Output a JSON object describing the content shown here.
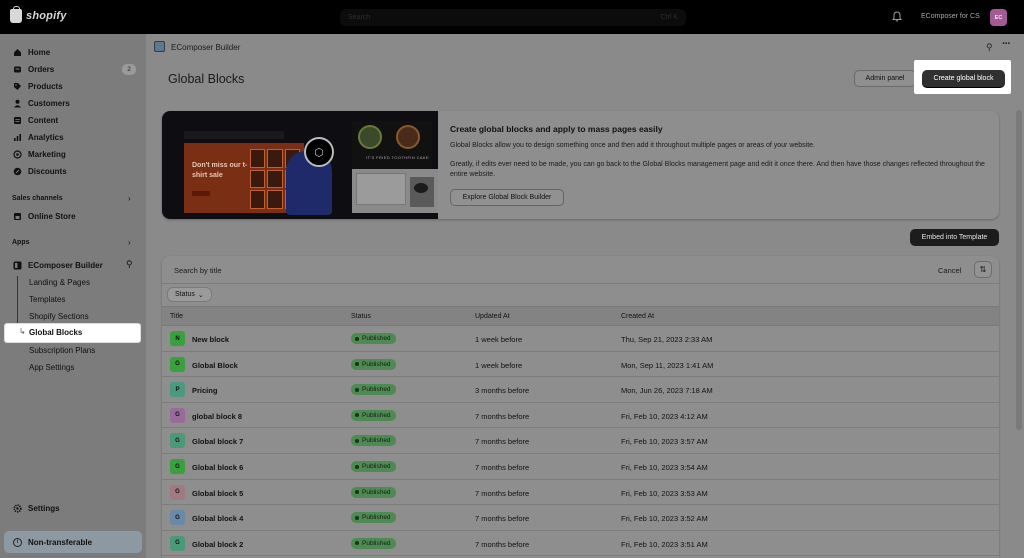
{
  "topbar": {
    "brand": "shopify",
    "search_placeholder": "Search",
    "search_shortcut": "Ctrl K",
    "store_name": "EComposer for CS",
    "avatar_initials": "EC"
  },
  "sidebar": {
    "items": [
      {
        "label": "Home",
        "icon": "home-icon"
      },
      {
        "label": "Orders",
        "icon": "orders-icon",
        "badge": "2"
      },
      {
        "label": "Products",
        "icon": "tag-icon"
      },
      {
        "label": "Customers",
        "icon": "person-icon"
      },
      {
        "label": "Content",
        "icon": "content-icon"
      },
      {
        "label": "Analytics",
        "icon": "analytics-icon"
      },
      {
        "label": "Marketing",
        "icon": "target-icon"
      },
      {
        "label": "Discounts",
        "icon": "discount-icon"
      }
    ],
    "sales_channels_title": "Sales channels",
    "online_store": "Online Store",
    "apps_title": "Apps",
    "app_name": "EComposer Builder",
    "sub_items": [
      "Landing & Pages",
      "Templates",
      "Shopify Sections",
      "Global Blocks",
      "Subscription Plans",
      "App Settings"
    ],
    "settings": "Settings",
    "non_transferable": "Non-transferable"
  },
  "app_header": {
    "title": "EComposer Builder"
  },
  "page": {
    "title": "Global Blocks",
    "admin_panel": "Admin panel",
    "create_button": "Create global block"
  },
  "banner": {
    "image_text": "Don't miss our t-shirt sale",
    "image_caption": "IT'S FRIED TOOTHFIN CAKE",
    "heading": "Create global blocks and apply to mass pages easily",
    "paragraph1": "Global Blocks allow you to design something once and then add it throughout multiple pages or areas of your website.",
    "paragraph2": "Greatly, if edits ever need to be made, you can go back to the Global Blocks management page and edit it once there. And then have those changes reflected throughout the entire website.",
    "explore_button": "Explore Global Block Builder"
  },
  "embed_button": "Embed into Template",
  "table": {
    "search_placeholder": "Search by title",
    "cancel": "Cancel",
    "status_filter": "Status",
    "columns": [
      "Title",
      "Status",
      "Updated At",
      "Created At"
    ],
    "rows": [
      {
        "initial": "N",
        "color": "#3aa03e",
        "title": "New block",
        "status": "Published",
        "updated": "1 week before",
        "created": "Thu, Sep 21, 2023 2:33 AM"
      },
      {
        "initial": "G",
        "color": "#3aa03e",
        "title": "Global Block",
        "status": "Published",
        "updated": "1 week before",
        "created": "Mon, Sep 11, 2023 1:41 AM"
      },
      {
        "initial": "P",
        "color": "#4b9a80",
        "title": "Pricing",
        "status": "Published",
        "updated": "3 months before",
        "created": "Mon, Jun 26, 2023 7:18 AM"
      },
      {
        "initial": "G",
        "color": "#9a6a9a",
        "title": "global block 8",
        "status": "Published",
        "updated": "7 months before",
        "created": "Fri, Feb 10, 2023 4:12 AM"
      },
      {
        "initial": "G",
        "color": "#4a9a7a",
        "title": "Global block 7",
        "status": "Published",
        "updated": "7 months before",
        "created": "Fri, Feb 10, 2023 3:57 AM"
      },
      {
        "initial": "G",
        "color": "#3aa03e",
        "title": "Global block 6",
        "status": "Published",
        "updated": "7 months before",
        "created": "Fri, Feb 10, 2023 3:54 AM"
      },
      {
        "initial": "G",
        "color": "#a07a80",
        "title": "Global block 5",
        "status": "Published",
        "updated": "7 months before",
        "created": "Fri, Feb 10, 2023 3:53 AM"
      },
      {
        "initial": "G",
        "color": "#6a88a8",
        "title": "Global block 4",
        "status": "Published",
        "updated": "7 months before",
        "created": "Fri, Feb 10, 2023 3:52 AM"
      },
      {
        "initial": "G",
        "color": "#4a9a7a",
        "title": "Global block 2",
        "status": "Published",
        "updated": "7 months before",
        "created": "Fri, Feb 10, 2023 3:51 AM"
      }
    ]
  }
}
